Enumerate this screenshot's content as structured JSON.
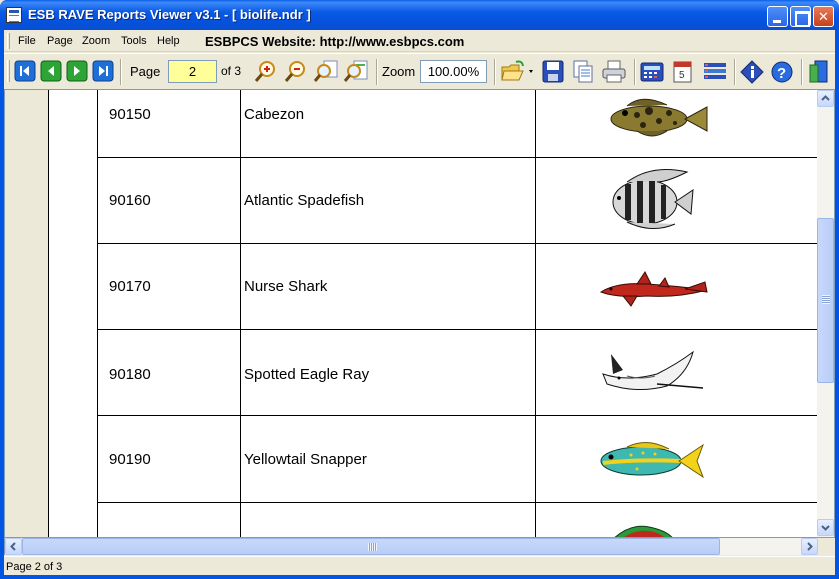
{
  "window": {
    "title": "ESB RAVE Reports Viewer v3.1 - [ biolife.ndr ]",
    "minimize_label": "",
    "maximize_label": "",
    "close_label": "✕"
  },
  "menu": {
    "items": [
      "File",
      "Page",
      "Zoom",
      "Tools",
      "Help"
    ],
    "website": "ESBPCS Website: http://www.esbpcs.com"
  },
  "toolbar": {
    "page_label": "Page",
    "page_value": "2",
    "page_of": "of 3",
    "zoom_label": "Zoom",
    "zoom_value": "100.00%",
    "icons": [
      "first-page-icon",
      "previous-page-icon",
      "next-page-icon",
      "last-page-icon",
      "zoom-in-icon",
      "zoom-out-icon",
      "zoom-page-width-icon",
      "zoom-fit-page-icon",
      "open-file-icon",
      "save-icon",
      "copy-icon",
      "print-icon",
      "calculator-icon",
      "calendar-icon",
      "list-icon",
      "info-icon",
      "help-icon",
      "exit-icon"
    ]
  },
  "report": {
    "rows": [
      {
        "number": "90150",
        "name": "Cabezon",
        "fish_icon": "cabezon-fish-image"
      },
      {
        "number": "90160",
        "name": "Atlantic Spadefish",
        "fish_icon": "spadefish-image"
      },
      {
        "number": "90170",
        "name": "Nurse Shark",
        "fish_icon": "nurse-shark-image"
      },
      {
        "number": "90180",
        "name": "Spotted Eagle Ray",
        "fish_icon": "eagle-ray-image"
      },
      {
        "number": "90190",
        "name": "Yellowtail Snapper",
        "fish_icon": "snapper-image"
      },
      {
        "number": "",
        "name": "",
        "fish_icon": "partial-fish-image"
      }
    ]
  },
  "status": {
    "text": "Page 2 of 3"
  },
  "colors": {
    "titlebar": "#0A5AE6",
    "chrome": "#ECE9D8",
    "page_input_bg": "#FFFF99"
  }
}
